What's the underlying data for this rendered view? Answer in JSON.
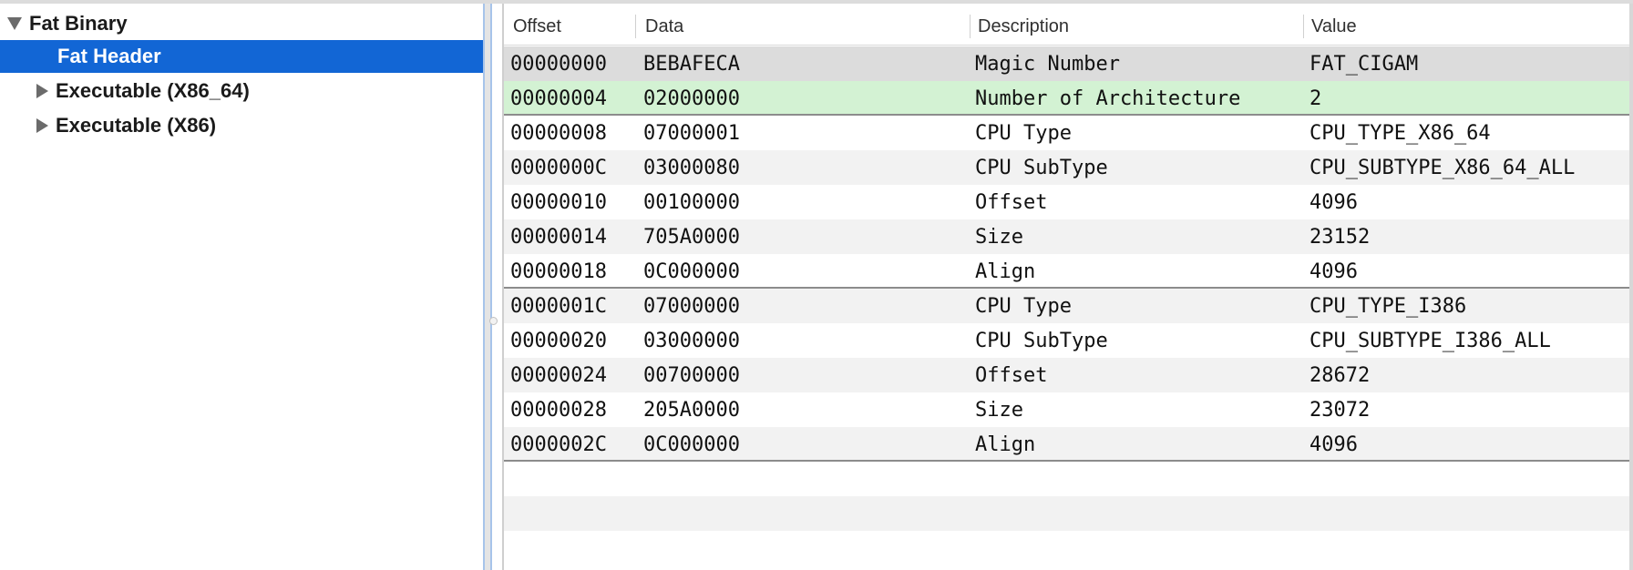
{
  "sidebar": {
    "items": [
      {
        "label": "Fat Binary",
        "expanded": true,
        "selected": false
      },
      {
        "label": "Fat Header",
        "expanded": null,
        "selected": true
      },
      {
        "label": "Executable (X86_64)",
        "expanded": false,
        "selected": false
      },
      {
        "label": "Executable (X86)",
        "expanded": false,
        "selected": false
      }
    ]
  },
  "table": {
    "columns": [
      "Offset",
      "Data",
      "Description",
      "Value"
    ],
    "rows": [
      {
        "offset": "00000000",
        "data": "BEBAFECA",
        "description": "Magic Number",
        "value": "FAT_CIGAM"
      },
      {
        "offset": "00000004",
        "data": "02000000",
        "description": "Number of Architecture",
        "value": "2"
      },
      {
        "offset": "00000008",
        "data": "07000001",
        "description": "CPU Type",
        "value": "CPU_TYPE_X86_64"
      },
      {
        "offset": "0000000C",
        "data": "03000080",
        "description": "CPU SubType",
        "value": "CPU_SUBTYPE_X86_64_ALL"
      },
      {
        "offset": "00000010",
        "data": "00100000",
        "description": "Offset",
        "value": "4096"
      },
      {
        "offset": "00000014",
        "data": "705A0000",
        "description": "Size",
        "value": "23152"
      },
      {
        "offset": "00000018",
        "data": "0C000000",
        "description": "Align",
        "value": "4096"
      },
      {
        "offset": "0000001C",
        "data": "07000000",
        "description": "CPU Type",
        "value": "CPU_TYPE_I386"
      },
      {
        "offset": "00000020",
        "data": "03000000",
        "description": "CPU SubType",
        "value": "CPU_SUBTYPE_I386_ALL"
      },
      {
        "offset": "00000024",
        "data": "00700000",
        "description": "Offset",
        "value": "28672"
      },
      {
        "offset": "00000028",
        "data": "205A0000",
        "description": "Size",
        "value": "23072"
      },
      {
        "offset": "0000002C",
        "data": "0C000000",
        "description": "Align",
        "value": "4096"
      }
    ]
  },
  "colors": {
    "selection": "#1266d5",
    "highlight_gray": "#dcdcdc",
    "highlight_green": "#d3f2d3",
    "stripe": "#f2f2f2"
  }
}
